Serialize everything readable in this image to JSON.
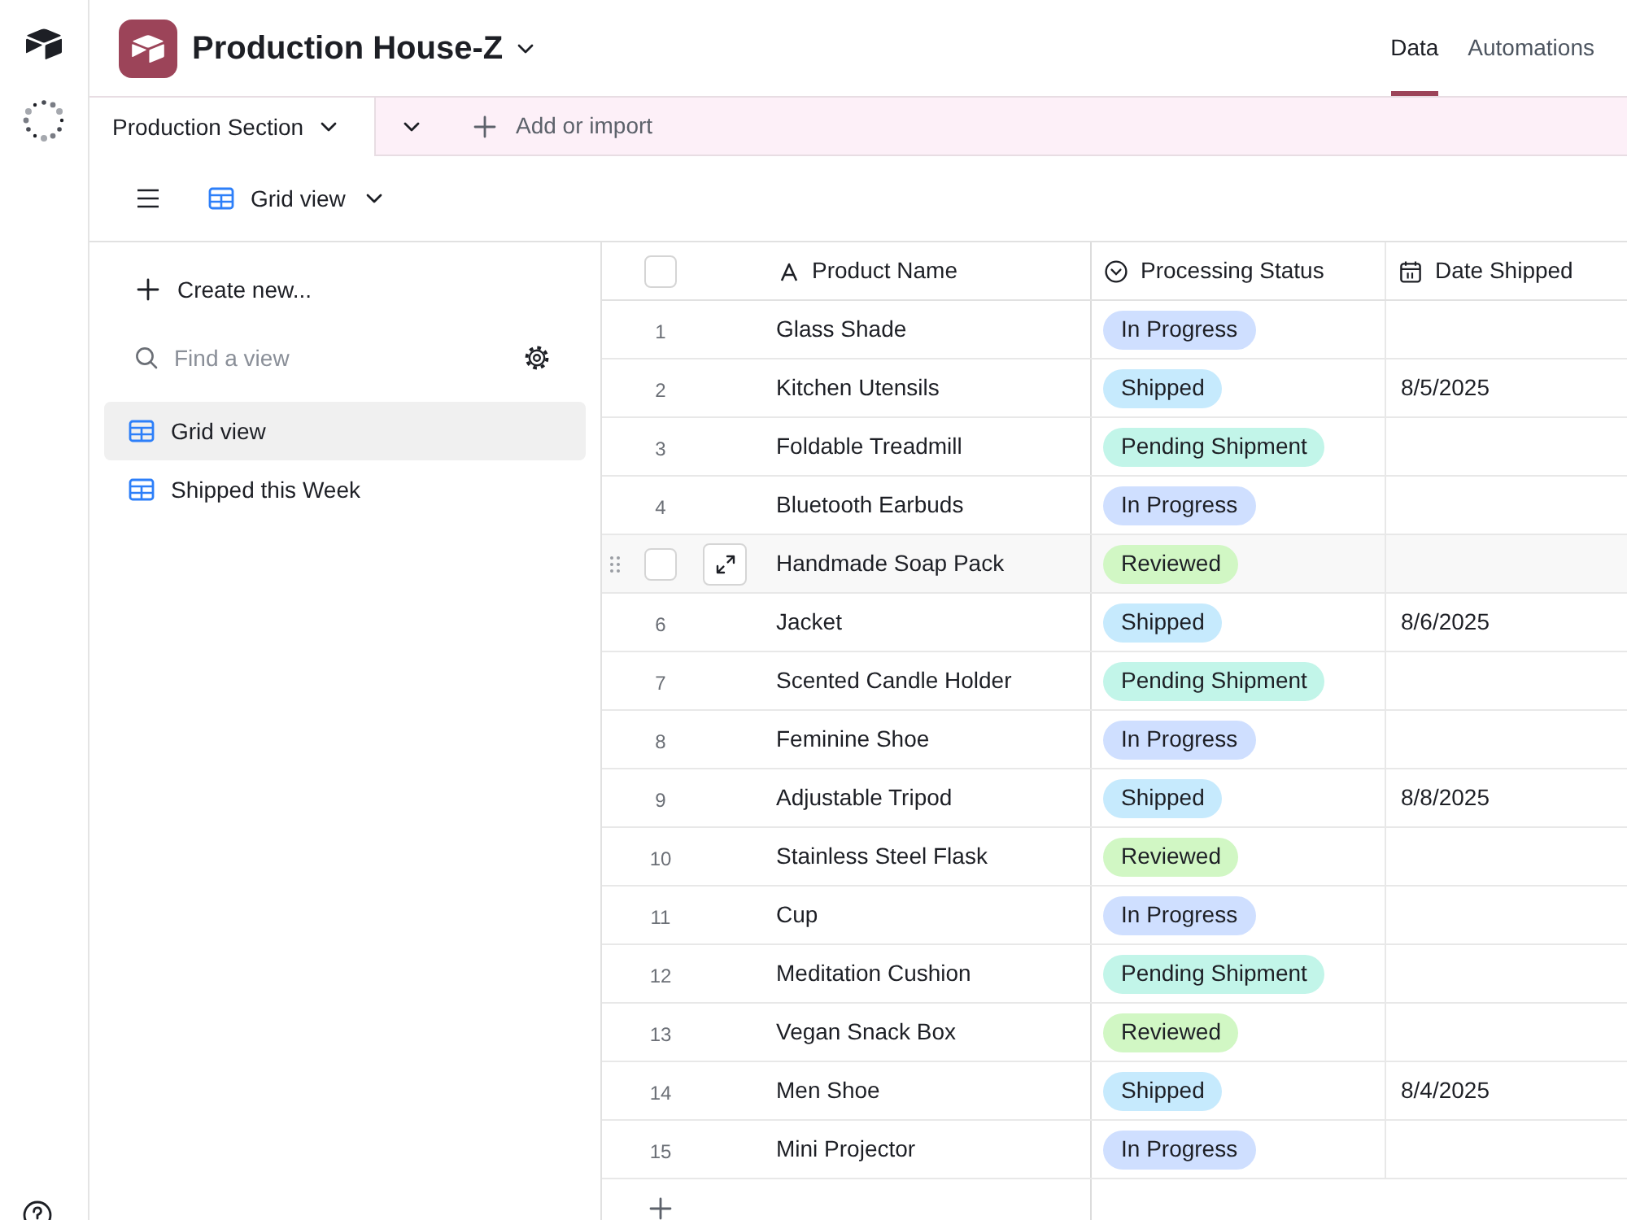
{
  "base": {
    "name": "Production House-Z"
  },
  "nav_tabs": [
    {
      "label": "Data",
      "selected": true
    },
    {
      "label": "Automations",
      "selected": false
    }
  ],
  "table_tabs": [
    {
      "label": "Production Section",
      "selected": true
    }
  ],
  "add_table": {
    "label": "Add or import"
  },
  "view_bar": {
    "current_view": "Grid view"
  },
  "sidebar": {
    "create_label": "Create new...",
    "search": {
      "placeholder": "Find a view"
    },
    "views": [
      {
        "label": "Grid view",
        "selected": true
      },
      {
        "label": "Shipped this Week",
        "selected": false
      }
    ]
  },
  "table": {
    "select_all": {
      "checked": false
    },
    "columns": [
      {
        "label": "Product Name",
        "kind": "text"
      },
      {
        "label": "Processing Status",
        "kind": "select"
      },
      {
        "label": "Date Shipped",
        "kind": "date"
      }
    ],
    "rows": [
      {
        "number": "1",
        "name": "Glass Shade",
        "status": {
          "label": "In Progress",
          "color": "#cfdfff"
        },
        "hovered": false
      },
      {
        "number": "2",
        "name": "Kitchen Utensils",
        "status": {
          "label": "Shipped",
          "color": "#c6eafd"
        },
        "date": "8/5/2025",
        "hovered": false
      },
      {
        "number": "3",
        "name": "Foldable Treadmill",
        "status": {
          "label": "Pending Shipment",
          "color": "#c2f5e9"
        },
        "hovered": false
      },
      {
        "number": "4",
        "name": "Bluetooth Earbuds",
        "status": {
          "label": "In Progress",
          "color": "#cfdfff"
        },
        "hovered": false
      },
      {
        "name": "Handmade Soap Pack",
        "status": {
          "label": "Reviewed",
          "color": "#d1f7c4"
        },
        "hovered": true
      },
      {
        "number": "6",
        "name": "Jacket",
        "status": {
          "label": "Shipped",
          "color": "#c6eafd"
        },
        "date": "8/6/2025",
        "hovered": false
      },
      {
        "number": "7",
        "name": "Scented Candle Holder",
        "status": {
          "label": "Pending Shipment",
          "color": "#c2f5e9"
        },
        "hovered": false
      },
      {
        "number": "8",
        "name": "Feminine Shoe",
        "status": {
          "label": "In Progress",
          "color": "#cfdfff"
        },
        "hovered": false
      },
      {
        "number": "9",
        "name": "Adjustable Tripod",
        "status": {
          "label": "Shipped",
          "color": "#c6eafd"
        },
        "date": "8/8/2025",
        "hovered": false
      },
      {
        "number": "10",
        "name": "Stainless Steel Flask",
        "status": {
          "label": "Reviewed",
          "color": "#d1f7c4"
        },
        "hovered": false
      },
      {
        "number": "11",
        "name": "Cup",
        "status": {
          "label": "In Progress",
          "color": "#cfdfff"
        },
        "hovered": false
      },
      {
        "number": "12",
        "name": "Meditation Cushion",
        "status": {
          "label": "Pending Shipment",
          "color": "#c2f5e9"
        },
        "hovered": false
      },
      {
        "number": "13",
        "name": "Vegan Snack Box",
        "status": {
          "label": "Reviewed",
          "color": "#d1f7c4"
        },
        "hovered": false
      },
      {
        "number": "14",
        "name": "Men Shoe",
        "status": {
          "label": "Shipped",
          "color": "#c6eafd"
        },
        "date": "8/4/2025",
        "hovered": false
      },
      {
        "number": "15",
        "name": "Mini Projector",
        "status": {
          "label": "In Progress",
          "color": "#cfdfff"
        },
        "hovered": false
      }
    ]
  }
}
